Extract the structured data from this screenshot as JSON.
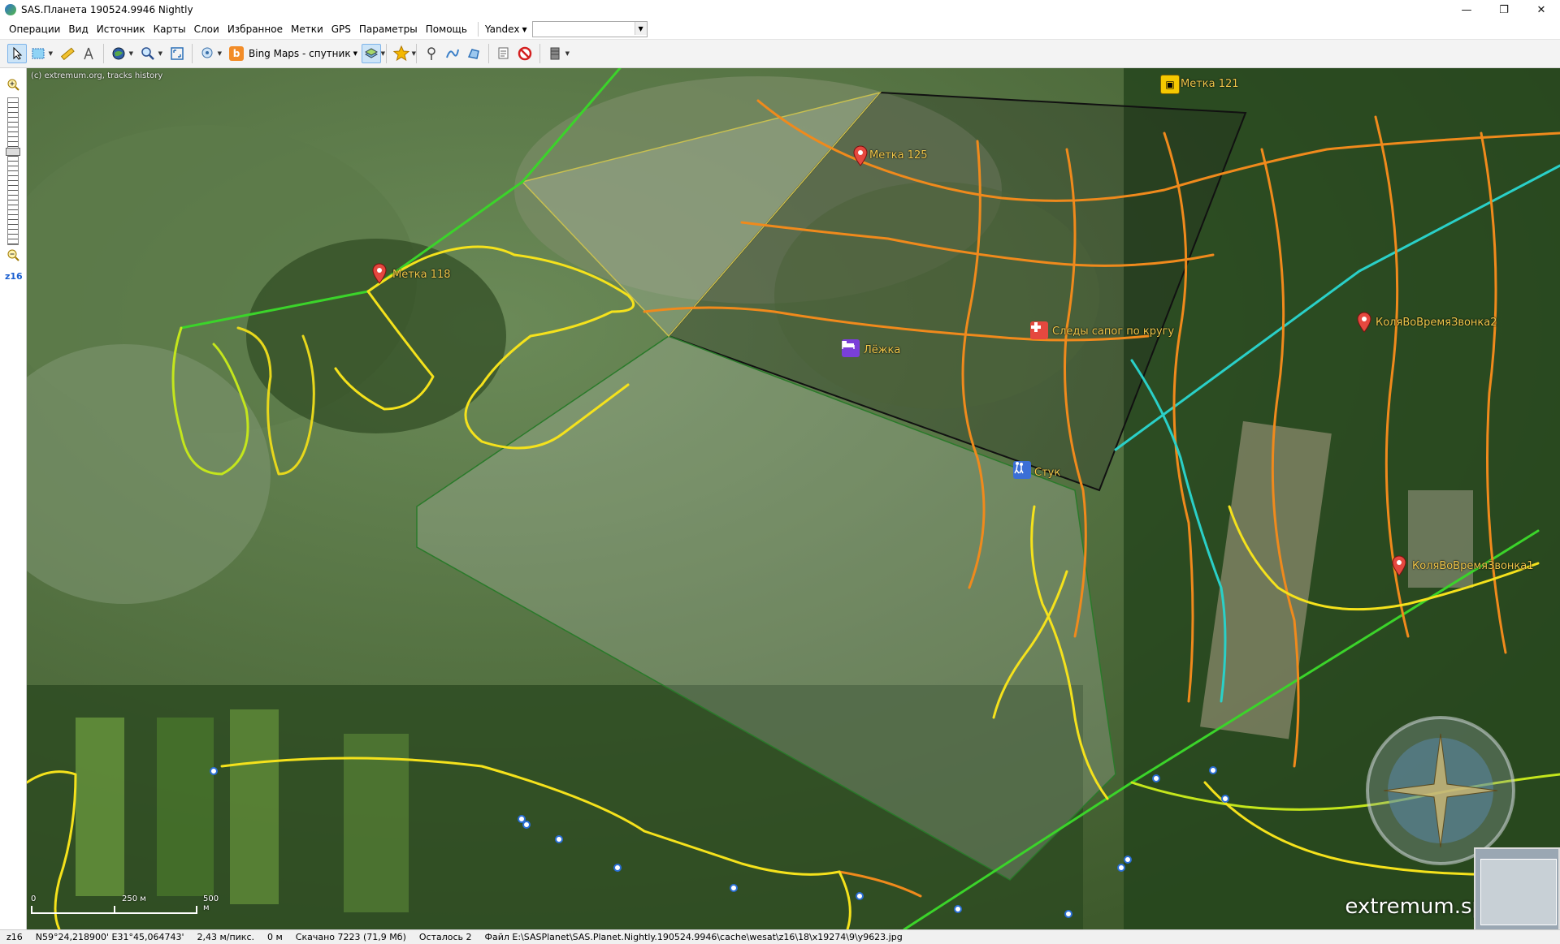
{
  "window": {
    "title": "SAS.Планета 190524.9946 Nightly",
    "minimize": "—",
    "restore": "❐",
    "close": "✕"
  },
  "menu": {
    "items": [
      "Операции",
      "Вид",
      "Источник",
      "Карты",
      "Слои",
      "Избранное",
      "Метки",
      "GPS",
      "Параметры",
      "Помощь"
    ],
    "search_provider": "Yandex",
    "search_value": ""
  },
  "toolbar": {
    "map_source": "Bing Maps - спутник"
  },
  "leftbar": {
    "zoom_level": "z16"
  },
  "map": {
    "copyright": "(c) extremum.org, tracks history",
    "placemarks": [
      {
        "label": "Метка 125"
      },
      {
        "label": "Метка 118"
      },
      {
        "label": "Метка 121"
      },
      {
        "label": "КоляВоВремяЗвонка2"
      },
      {
        "label": "КоляВоВремяЗвонка1"
      }
    ],
    "pois": [
      {
        "label": "Следы сапог по кругу",
        "icon": "first-aid-icon",
        "color": "#e5483f"
      },
      {
        "label": "Лёжка",
        "icon": "bed-icon",
        "color": "#7a3fd8"
      },
      {
        "label": "Стук",
        "icon": "hikers-icon",
        "color": "#3b6fd6"
      }
    ],
    "scale": {
      "mid": "250 м",
      "end": "500 м",
      "start": "0"
    },
    "watermark": "extremum.spb.ru",
    "colors": {
      "track_yellow": "#f5e21c",
      "track_orange": "#f08a1c",
      "track_green": "#3bd42a",
      "track_cyan": "#2ad0c8",
      "polygon_dark": "#1c1c1c",
      "polygon_light": "#d8d8d8"
    }
  },
  "status": {
    "zoom": "z16",
    "coords": "N59°24,218900' E31°45,064743'",
    "resolution": "2,43 м/пикс.",
    "distance": "0 м",
    "downloaded": "Скачано 7223 (71,9 Мб)",
    "remaining": "Осталось 2",
    "file": "Файл E:\\SASPlanet\\SAS.Planet.Nightly.190524.9946\\cache\\wesat\\z16\\18\\x19274\\9\\y9623.jpg"
  }
}
